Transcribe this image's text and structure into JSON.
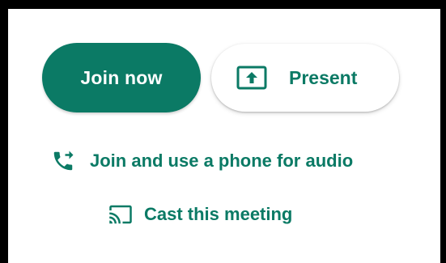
{
  "actions": {
    "join_now_label": "Join now",
    "present_label": "Present",
    "phone_audio_label": "Join and use a phone for audio",
    "cast_label": "Cast this meeting"
  },
  "icons": {
    "present": "present-screen-icon",
    "phone": "phone-forwarded-icon",
    "cast": "cast-icon"
  },
  "colors": {
    "accent": "#0b7a65",
    "frame": "#000000",
    "background": "#ffffff"
  }
}
